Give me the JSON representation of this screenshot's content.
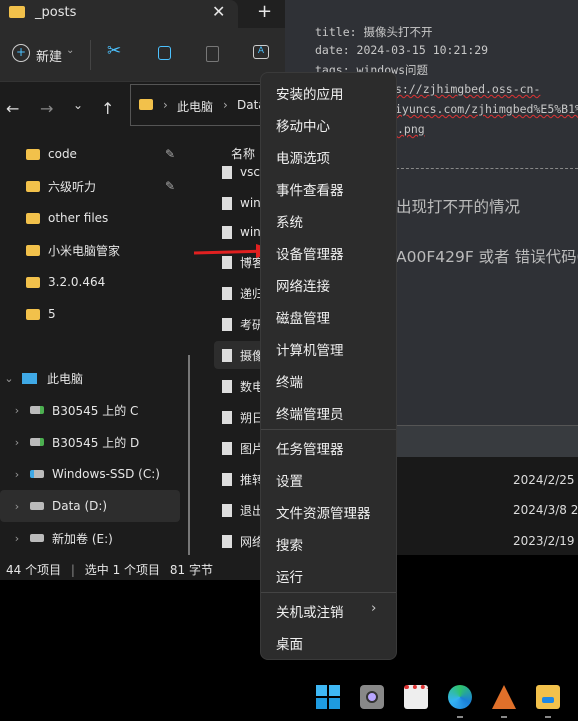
{
  "explorer": {
    "tab_title": "_posts",
    "toolbar": {
      "new_label": "新建"
    },
    "breadcrumb": [
      "此电脑",
      "Data"
    ],
    "quick_access": [
      {
        "label": "code",
        "pinned": true
      },
      {
        "label": "六级听力",
        "pinned": true
      },
      {
        "label": "other files",
        "pinned": false
      },
      {
        "label": "小米电脑管家",
        "pinned": false
      },
      {
        "label": "3.2.0.464",
        "pinned": false
      },
      {
        "label": "5",
        "pinned": false
      }
    ],
    "this_pc": "此电脑",
    "drives": [
      "B30545 上的 C",
      "B30545 上的 D",
      "Windows-SSD (C:)",
      "Data (D:)",
      "新加卷 (E:)"
    ],
    "column_name": "名称",
    "files": [
      "vsco",
      "win",
      "win",
      "博客",
      "递归",
      "考研",
      "摄像",
      "数电",
      "朔日",
      "图片",
      "推转",
      "退出",
      "网络"
    ],
    "status": {
      "count": "44 个项目",
      "selected": "选中 1 个项目",
      "size": "81 字节"
    }
  },
  "editor": {
    "lines": [
      "title: 摄像头打不开",
      "date: 2024-03-15 10:21:29",
      "tags: windows问题",
      "s://zjhimgbed.oss-cn-",
      "iyuncs.com/zjhimgbed%E5%B1%",
      ".png"
    ],
    "heading": "出现打不开的情况",
    "paragraph": "A00F429F 或者 错误代码0"
  },
  "dates": [
    "2024/2/25 8",
    "2024/3/8 20",
    "2023/2/19 1"
  ],
  "menu": {
    "items": [
      "安装的应用",
      "移动中心",
      "电源选项",
      "事件查看器",
      "系统",
      "设备管理器",
      "网络连接",
      "磁盘管理",
      "计算机管理",
      "终端",
      "终端管理员",
      "任务管理器",
      "设置",
      "文件资源管理器",
      "搜索",
      "运行",
      "关机或注销",
      "桌面"
    ]
  },
  "taskbar": {
    "icons": [
      "windows-start-icon",
      "camera-icon",
      "snipping-tool-icon",
      "edge-icon",
      "matlab-icon",
      "file-explorer-icon"
    ]
  },
  "colors": {
    "annotation_arrow": "#e02020",
    "folder": "#f2c14b",
    "accent": "#4cc2ff"
  }
}
